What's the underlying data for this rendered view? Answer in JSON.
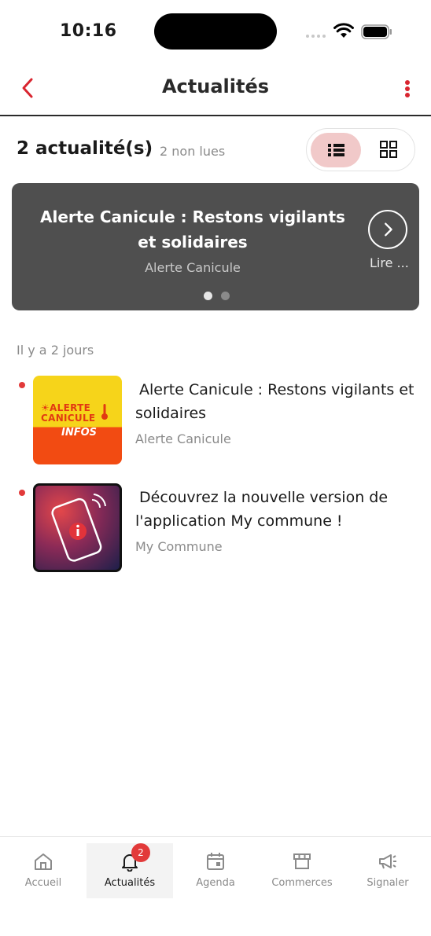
{
  "status_bar": {
    "time": "10:16"
  },
  "header": {
    "title": "Actualités"
  },
  "summary": {
    "count_label": "2 actualité(s)",
    "separator": "·",
    "unread_label": "2 non lues"
  },
  "carousel": {
    "title": "Alerte Canicule : Restons vigilants et solidaires",
    "subtitle": "Alerte Canicule",
    "read_more": "Lire ...",
    "page_count": 2,
    "active_page": 1
  },
  "list": {
    "day_label": "Il y a 2 jours",
    "items": [
      {
        "title": "Alerte Canicule : Restons vigilants et solidaires",
        "source": "Alerte Canicule",
        "thumb_line1": "☀ALERTE",
        "thumb_line2": "CANICULE",
        "thumb_line3": "INFOS"
      },
      {
        "title": "Découvrez la nouvelle version de l'application My commune !",
        "source": "My Commune"
      }
    ]
  },
  "bottom_nav": {
    "items": [
      {
        "label": "Accueil",
        "icon": "home-icon"
      },
      {
        "label": "Actualités",
        "icon": "bell-icon",
        "badge": "2",
        "active": true
      },
      {
        "label": "Agenda",
        "icon": "calendar-icon"
      },
      {
        "label": "Commerces",
        "icon": "store-icon"
      },
      {
        "label": "Signaler",
        "icon": "megaphone-icon"
      }
    ]
  },
  "colors": {
    "accent": "#d9252f",
    "toggle_active_bg": "#f1c9c9",
    "carousel_bg": "#4f4f4f"
  }
}
